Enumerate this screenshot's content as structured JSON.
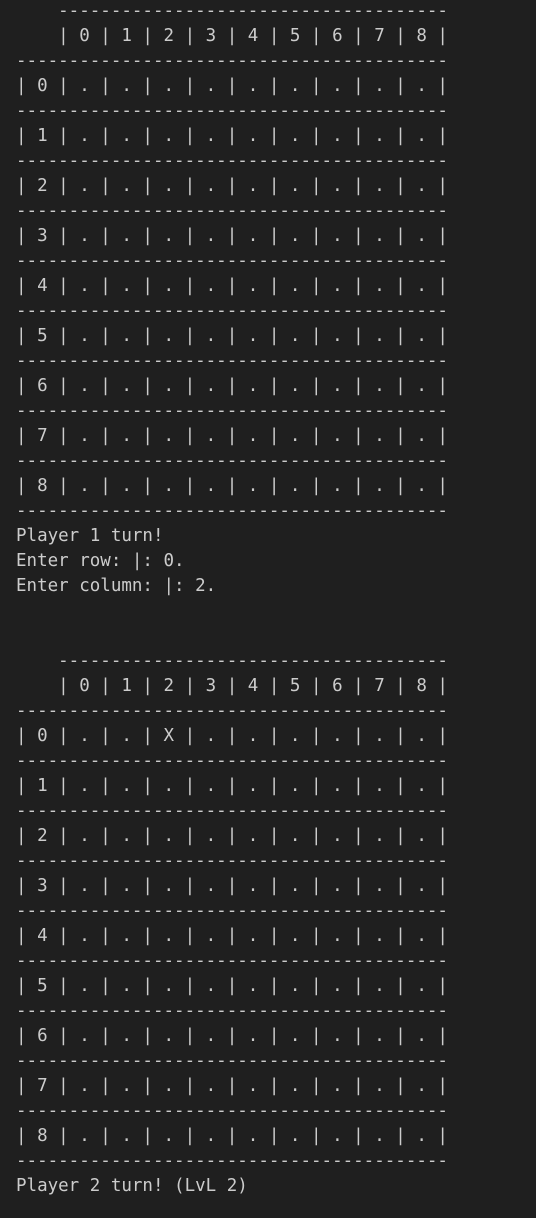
{
  "terminal": {
    "lines": [
      "    -------------------------------------",
      "    | 0 | 1 | 2 | 3 | 4 | 5 | 6 | 7 | 8 |",
      "-----------------------------------------",
      "| 0 | . | . | . | . | . | . | . | . | . |",
      "-----------------------------------------",
      "| 1 | . | . | . | . | . | . | . | . | . |",
      "-----------------------------------------",
      "| 2 | . | . | . | . | . | . | . | . | . |",
      "-----------------------------------------",
      "| 3 | . | . | . | . | . | . | . | . | . |",
      "-----------------------------------------",
      "| 4 | . | . | . | . | . | . | . | . | . |",
      "-----------------------------------------",
      "| 5 | . | . | . | . | . | . | . | . | . |",
      "-----------------------------------------",
      "| 6 | . | . | . | . | . | . | . | . | . |",
      "-----------------------------------------",
      "| 7 | . | . | . | . | . | . | . | . | . |",
      "-----------------------------------------",
      "| 8 | . | . | . | . | . | . | . | . | . |",
      "-----------------------------------------",
      "Player 1 turn!",
      "Enter row: |: 0.",
      "Enter column: |: 2.",
      "",
      "",
      "    -------------------------------------",
      "    | 0 | 1 | 2 | 3 | 4 | 5 | 6 | 7 | 8 |",
      "-----------------------------------------",
      "| 0 | . | . | X | . | . | . | . | . | . |",
      "-----------------------------------------",
      "| 1 | . | . | . | . | . | . | . | . | . |",
      "-----------------------------------------",
      "| 2 | . | . | . | . | . | . | . | . | . |",
      "-----------------------------------------",
      "| 3 | . | . | . | . | . | . | . | . | . |",
      "-----------------------------------------",
      "| 4 | . | . | . | . | . | . | . | . | . |",
      "-----------------------------------------",
      "| 5 | . | . | . | . | . | . | . | . | . |",
      "-----------------------------------------",
      "| 6 | . | . | . | . | . | . | . | . | . |",
      "-----------------------------------------",
      "| 7 | . | . | . | . | . | . | . | . | . |",
      "-----------------------------------------",
      "| 8 | . | . | . | . | . | . | . | . | . |",
      "-----------------------------------------",
      "Player 2 turn! (LvL 2)"
    ]
  }
}
